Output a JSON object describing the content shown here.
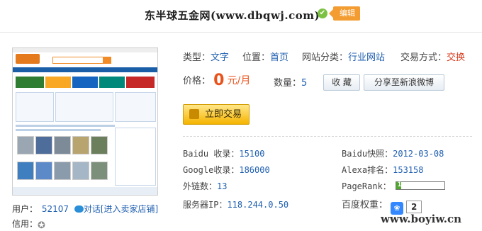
{
  "header": {
    "title": "东半球五金网(www.dbqwj.com)",
    "edit_label": "编辑",
    "verified_icon": "check-icon"
  },
  "seller": {
    "user_label": "用户：",
    "user_id": "52107",
    "chat_label": "对话",
    "store_link": "[进入卖家店铺]",
    "credit_label": "信用："
  },
  "meta": {
    "type_key": "类型：",
    "type_val": "文字",
    "position_key": "位置：",
    "position_val": "首页",
    "category_key": "网站分类：",
    "category_val": "行业网站",
    "trade_key": "交易方式：",
    "trade_val": "交换"
  },
  "price": {
    "label": "价格：",
    "amount": "0",
    "unit": "元/月",
    "qty_label": "数量：",
    "qty": "5"
  },
  "buttons": {
    "favorite": "收 藏",
    "share": "分享至新浪微博",
    "trade": "立即交易"
  },
  "stats": {
    "baidu_index_key": "Baidu 收录：",
    "baidu_index_val": "15100",
    "baidu_snapshot_key": "Baidu快照：",
    "baidu_snapshot_val": "2012-03-08",
    "google_index_key": "Google收录：",
    "google_index_val": "186000",
    "alexa_key": "Alexa排名：",
    "alexa_val": "153158",
    "outlinks_key": "外链数：",
    "outlinks_val": "13",
    "pagerank_key": "PageRank：",
    "pagerank_val": "1",
    "pagerank_fraction": 0.1,
    "ip_key": "服务器IP：",
    "ip_val": "118.244.0.50",
    "baidu_weight_key": "百度权重：",
    "baidu_weight_val": "2"
  },
  "watermark": "www.boyiw.cn",
  "colors": {
    "accent": "#f39c31",
    "link": "#1f5fb0",
    "price": "#e8531c",
    "trade_red": "#d93b1e"
  }
}
